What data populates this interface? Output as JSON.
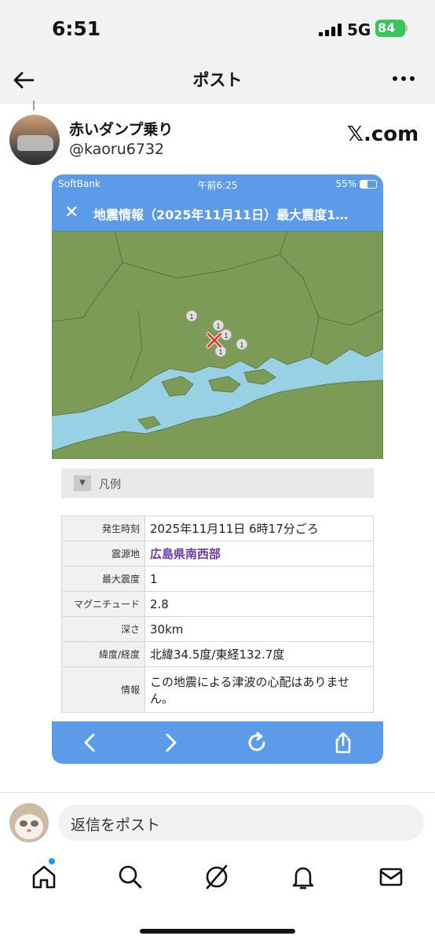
{
  "status_bar": {
    "time": "6:51",
    "network": "5G",
    "battery": "84"
  },
  "header": {
    "title": "ポスト"
  },
  "post": {
    "author_name": "赤いダンプ乗り",
    "author_handle": "@kaoru6732",
    "source": "𝕏.com"
  },
  "embedded": {
    "status": {
      "carrier": "SoftBank",
      "time": "午前6:25",
      "battery": "55%"
    },
    "nav_title": "地震情報（2025年11月11日）最大震度1…",
    "map_markers": [
      "1",
      "1",
      "1",
      "1",
      "1"
    ],
    "legend_label": "凡例",
    "rows": [
      {
        "key": "発生時刻",
        "value": "2025年11月11日 6時17分ごろ"
      },
      {
        "key": "震源地",
        "value": "広島県南西部"
      },
      {
        "key": "最大震度",
        "value": "1"
      },
      {
        "key": "マグニチュード",
        "value": "2.8"
      },
      {
        "key": "深さ",
        "value": "30km"
      },
      {
        "key": "緯度/経度",
        "value": "北緯34.5度/東経132.7度"
      },
      {
        "key": "情報",
        "value": "この地震による津波の心配はありません。"
      }
    ]
  },
  "reply": {
    "placeholder": "返信をポスト"
  },
  "colors": {
    "accent": "#1d9bf0",
    "browser_bar": "#5b9bea",
    "land": "#7b9b56",
    "sea": "#97d1e3",
    "link": "#6b3aa8"
  }
}
